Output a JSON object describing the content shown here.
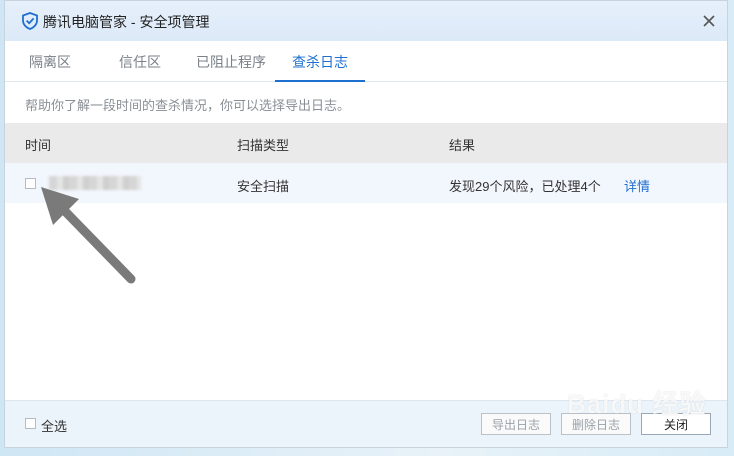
{
  "window": {
    "title": "腾讯电脑管家 - 安全项管理"
  },
  "tabs": [
    {
      "label": "隔离区",
      "active": false
    },
    {
      "label": "信任区",
      "active": false
    },
    {
      "label": "已阻止程序",
      "active": false
    },
    {
      "label": "查杀日志",
      "active": true
    }
  ],
  "info_text": "帮助你了解一段时间的查杀情况，你可以选择导出日志。",
  "table": {
    "headers": [
      "时间",
      "扫描类型",
      "结果"
    ],
    "rows": [
      {
        "time": "",
        "scan_type": "安全扫描",
        "result": "发现29个风险，已处理4个",
        "detail_link": "详情"
      }
    ]
  },
  "footer": {
    "select_all": "全选",
    "export_button": "导出日志",
    "delete_button": "删除日志",
    "close_button": "关闭"
  },
  "watermark": "Baidu 经验",
  "colors": {
    "accent": "#1f6fd1",
    "header_bg": "#eaeaea",
    "row_bg": "#f2f6fd"
  }
}
